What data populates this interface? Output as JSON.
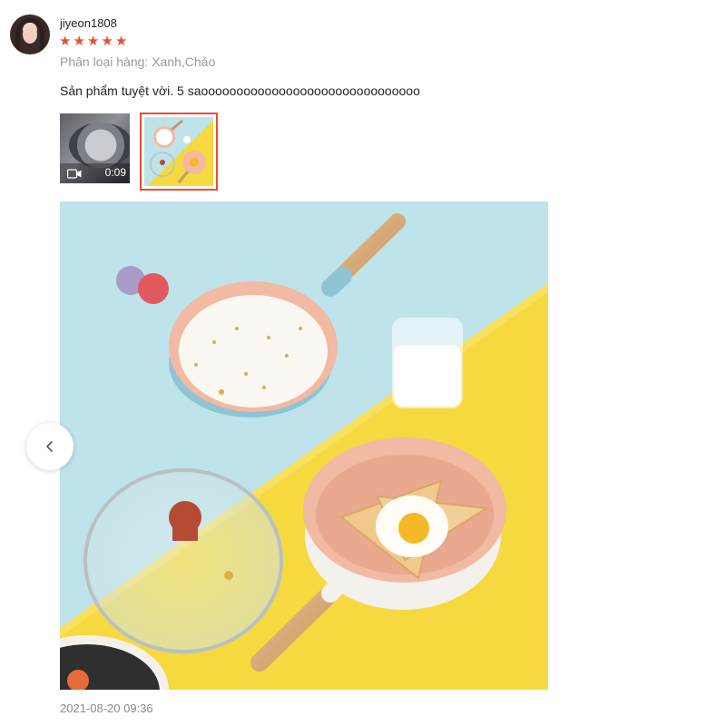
{
  "review": {
    "username": "jiyeon1808",
    "rating": 5,
    "variant": "Phân loại hàng: Xanh,Chảo",
    "comment": "Sản phẩm tuyệt vời. 5 saooooooooooooooooooooooooooooooo",
    "timestamp": "2021-08-20 09:36"
  },
  "media": {
    "video_duration": "0:09",
    "selected_index": 1
  },
  "colors": {
    "star": "#ee4d2d",
    "selected_border": "#ee4d2d",
    "photo_bg_blue": "#bfe3ea",
    "photo_bg_yellow": "#f6d93f"
  },
  "icons": {
    "rating": "star-icon",
    "video": "video-camera-icon",
    "prev": "chevron-left-icon"
  }
}
